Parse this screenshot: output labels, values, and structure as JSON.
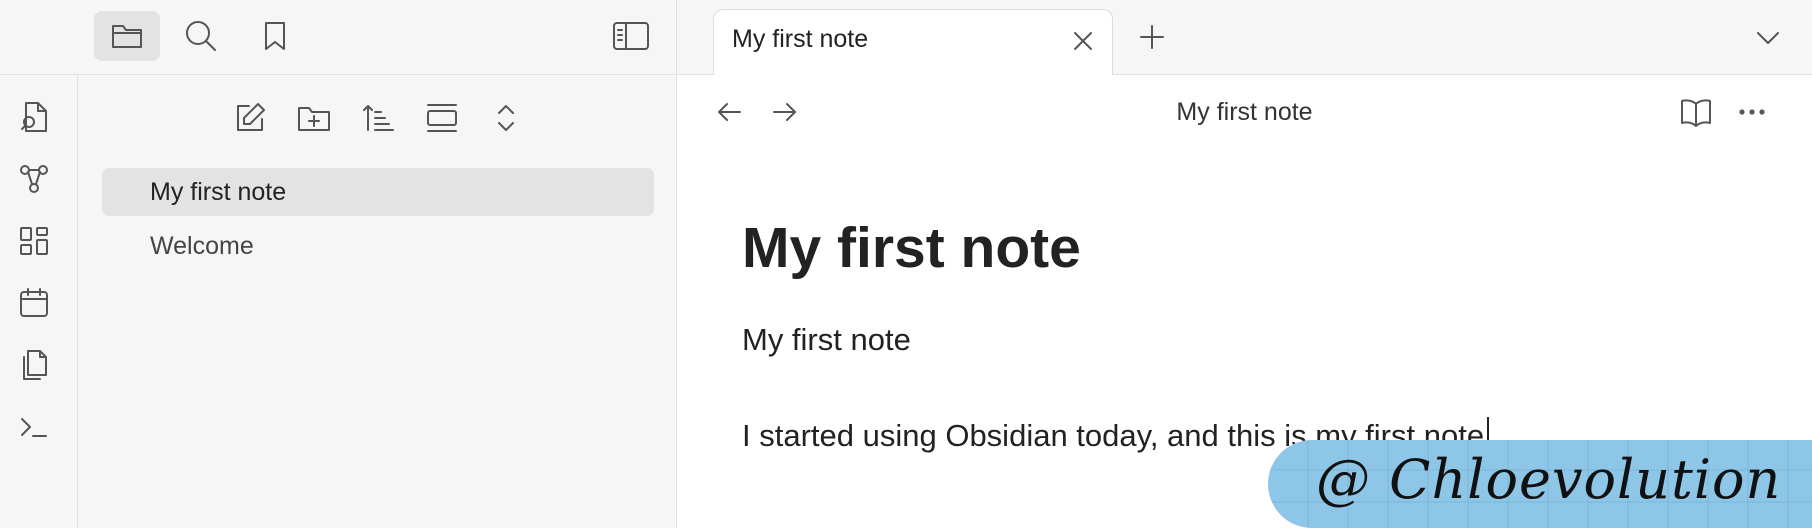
{
  "left_topbar": {
    "icons": [
      "folder-icon",
      "search-icon",
      "bookmark-icon",
      "sidebar-toggle-icon"
    ]
  },
  "ribbon": {
    "icons": [
      "open-quick-switcher-icon",
      "graph-view-icon",
      "canvas-icon",
      "daily-note-icon",
      "templates-icon",
      "command-palette-icon"
    ]
  },
  "explorer_toolbar": {
    "icons": [
      "new-note-icon",
      "new-folder-icon",
      "sort-icon",
      "auto-reveal-icon",
      "collapse-all-icon"
    ]
  },
  "files": [
    {
      "label": "My first note",
      "active": true
    },
    {
      "label": "Welcome",
      "active": false
    }
  ],
  "tabs": {
    "active_title": "My first note"
  },
  "view_header": {
    "title": "My first note"
  },
  "note": {
    "heading": "My first note",
    "line1": "My first note",
    "line2": "I started using Obsidian today, and this is my first note"
  },
  "watermark": {
    "text": "@ Chloevolution"
  },
  "colors": {
    "sidebar_bg": "#f6f6f6",
    "active_item_bg": "#e3e3e3",
    "watermark_bg": "#8ec6e8"
  }
}
